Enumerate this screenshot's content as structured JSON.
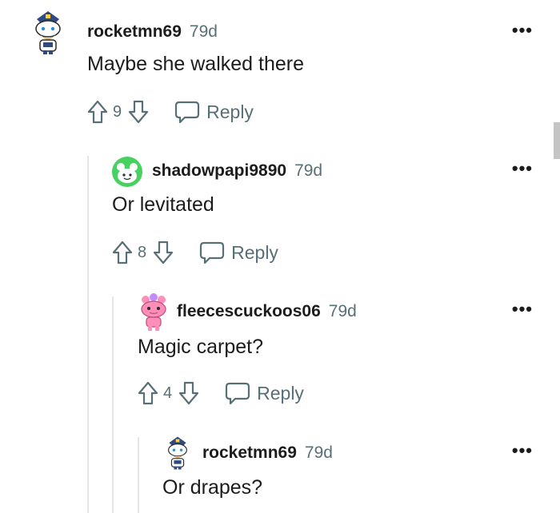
{
  "comments": [
    {
      "username": "rocketmn69",
      "age": "79d",
      "text": "Maybe she walked there",
      "votes": "9",
      "reply_label": "Reply",
      "avatar": "snoo-blue-cap-avatar"
    },
    {
      "username": "shadowpapi9890",
      "age": "79d",
      "text": "Or levitated",
      "votes": "8",
      "reply_label": "Reply",
      "avatar": "snoo-green-avatar"
    },
    {
      "username": "fleecescuckoos06",
      "age": "79d",
      "text": "Magic carpet?",
      "votes": "4",
      "reply_label": "Reply",
      "avatar": "snoo-pink-avatar"
    },
    {
      "username": "rocketmn69",
      "age": "79d",
      "text": "Or drapes?",
      "avatar": "snoo-blue-cap-avatar"
    }
  ],
  "colors": {
    "text": "#1c1c1c",
    "muted": "#576f76",
    "thread_line": "#e6e6e6",
    "green_avatar": "#46d160",
    "pink_avatar": "#ff8fb8"
  }
}
